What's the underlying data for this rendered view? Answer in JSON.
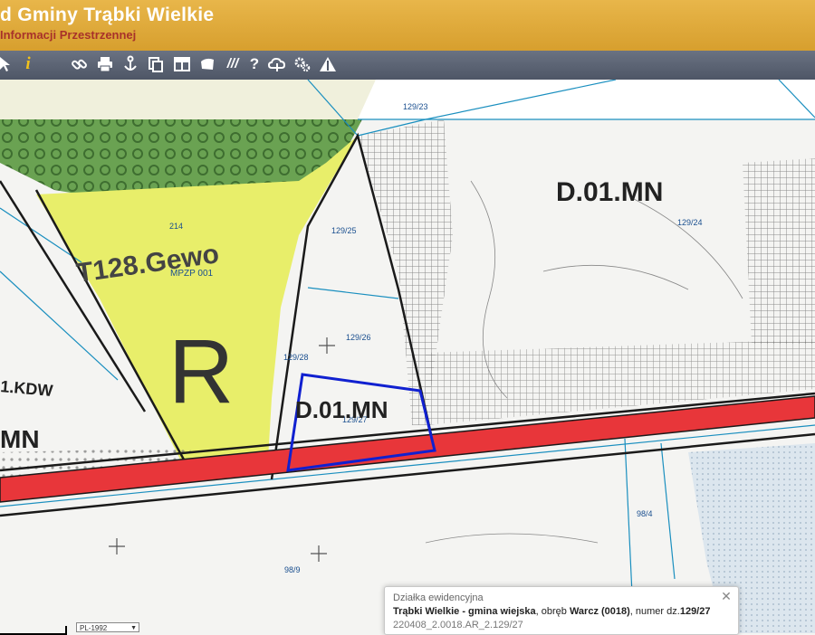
{
  "header": {
    "title": "d Gminy Trąbki Wielkie",
    "subtitle": "Informacji Przestrzennej"
  },
  "toolbar": {
    "tools": [
      "cursor-icon",
      "info-icon",
      "link-icon",
      "print-icon",
      "anchor-icon",
      "copy-icon",
      "layout-icon",
      "shape-icon",
      "hatch-icon",
      "help-icon",
      "cloud-icon",
      "settings-icon",
      "measure-icon"
    ]
  },
  "map": {
    "labels": {
      "p129_23": "129/23",
      "p129_24": "129/24",
      "p129_25": "129/25",
      "p129_26": "129/26",
      "p129_27": "129/27",
      "p129_28": "129/28",
      "p214": "214",
      "p98_4": "98/4",
      "p98_9": "98/9",
      "mpzp": "MPZP 001",
      "zone_r": "R",
      "zone_d1": "D.01.MN",
      "zone_d2": "D.01.MN",
      "kdw": "1.KDW",
      "mn": "MN",
      "t128": "T128.Gewo"
    }
  },
  "popup": {
    "header": "Działka ewidencyjna",
    "gmina": "Trąbki Wielkie - gmina wiejska",
    "sep1": ", obręb ",
    "obreb": "Warcz (0018)",
    "sep2": ", numer dz.",
    "numer": "129/27",
    "ref": "220408_2.0018.AR_2.129/27",
    "close_icon": "close-icon"
  },
  "crs_select": {
    "value": "PL-1992"
  },
  "colors": {
    "header": "#d79f2e",
    "toolbar": "#5a6272",
    "road": "#e8363a",
    "agri_zone": "#e8ee6a",
    "forest": "#5e9a48",
    "selection": "#1020d0",
    "parcel_line": "#1a8fbf"
  }
}
